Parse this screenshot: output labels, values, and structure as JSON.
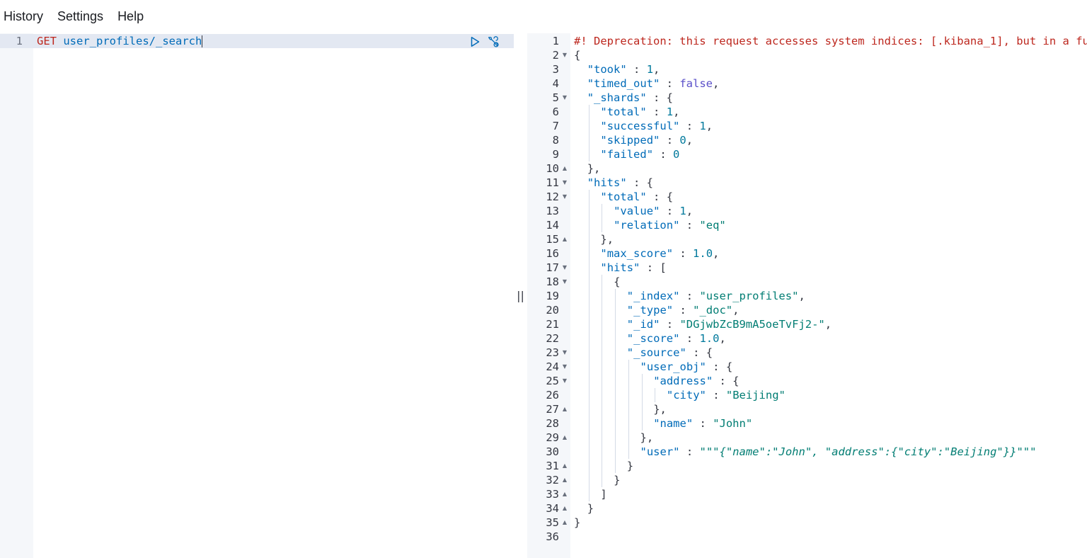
{
  "menubar": {
    "items": [
      "History",
      "Settings",
      "Help"
    ]
  },
  "request": {
    "line_number": "1",
    "method": "GET",
    "path": "user_profiles/_search"
  },
  "icons": {
    "run": "play-icon",
    "settings": "wrench-icon",
    "resizer": "drag-handle-icon"
  },
  "resizer_label": "||",
  "response": {
    "lines": [
      {
        "n": "1",
        "fold": "",
        "indent": 0,
        "tokens": [
          [
            "warn",
            "#! Deprecation: this request accesses system indices: [.kibana_1], but in a future major version, direct access"
          ]
        ]
      },
      {
        "n": "2",
        "fold": "down",
        "indent": 0,
        "tokens": [
          [
            "p",
            "{"
          ]
        ]
      },
      {
        "n": "3",
        "fold": "",
        "indent": 1,
        "tokens": [
          [
            "k",
            "\"took\""
          ],
          [
            "p",
            " : "
          ],
          [
            "n",
            "1"
          ],
          [
            "p",
            ","
          ]
        ]
      },
      {
        "n": "4",
        "fold": "",
        "indent": 1,
        "tokens": [
          [
            "k",
            "\"timed_out\""
          ],
          [
            "p",
            " : "
          ],
          [
            "b",
            "false"
          ],
          [
            "p",
            ","
          ]
        ]
      },
      {
        "n": "5",
        "fold": "down",
        "indent": 1,
        "tokens": [
          [
            "k",
            "\"_shards\""
          ],
          [
            "p",
            " : {"
          ]
        ]
      },
      {
        "n": "6",
        "fold": "",
        "indent": 2,
        "tokens": [
          [
            "k",
            "\"total\""
          ],
          [
            "p",
            " : "
          ],
          [
            "n",
            "1"
          ],
          [
            "p",
            ","
          ]
        ]
      },
      {
        "n": "7",
        "fold": "",
        "indent": 2,
        "tokens": [
          [
            "k",
            "\"successful\""
          ],
          [
            "p",
            " : "
          ],
          [
            "n",
            "1"
          ],
          [
            "p",
            ","
          ]
        ]
      },
      {
        "n": "8",
        "fold": "",
        "indent": 2,
        "tokens": [
          [
            "k",
            "\"skipped\""
          ],
          [
            "p",
            " : "
          ],
          [
            "n",
            "0"
          ],
          [
            "p",
            ","
          ]
        ]
      },
      {
        "n": "9",
        "fold": "",
        "indent": 2,
        "tokens": [
          [
            "k",
            "\"failed\""
          ],
          [
            "p",
            " : "
          ],
          [
            "n",
            "0"
          ]
        ]
      },
      {
        "n": "10",
        "fold": "up",
        "indent": 1,
        "tokens": [
          [
            "p",
            "},"
          ]
        ]
      },
      {
        "n": "11",
        "fold": "down",
        "indent": 1,
        "tokens": [
          [
            "k",
            "\"hits\""
          ],
          [
            "p",
            " : {"
          ]
        ]
      },
      {
        "n": "12",
        "fold": "down",
        "indent": 2,
        "tokens": [
          [
            "k",
            "\"total\""
          ],
          [
            "p",
            " : {"
          ]
        ]
      },
      {
        "n": "13",
        "fold": "",
        "indent": 3,
        "tokens": [
          [
            "k",
            "\"value\""
          ],
          [
            "p",
            " : "
          ],
          [
            "n",
            "1"
          ],
          [
            "p",
            ","
          ]
        ]
      },
      {
        "n": "14",
        "fold": "",
        "indent": 3,
        "tokens": [
          [
            "k",
            "\"relation\""
          ],
          [
            "p",
            " : "
          ],
          [
            "s",
            "\"eq\""
          ]
        ]
      },
      {
        "n": "15",
        "fold": "up",
        "indent": 2,
        "tokens": [
          [
            "p",
            "},"
          ]
        ]
      },
      {
        "n": "16",
        "fold": "",
        "indent": 2,
        "tokens": [
          [
            "k",
            "\"max_score\""
          ],
          [
            "p",
            " : "
          ],
          [
            "n",
            "1.0"
          ],
          [
            "p",
            ","
          ]
        ]
      },
      {
        "n": "17",
        "fold": "down",
        "indent": 2,
        "tokens": [
          [
            "k",
            "\"hits\""
          ],
          [
            "p",
            " : ["
          ]
        ]
      },
      {
        "n": "18",
        "fold": "down",
        "indent": 3,
        "tokens": [
          [
            "p",
            "{"
          ]
        ]
      },
      {
        "n": "19",
        "fold": "",
        "indent": 4,
        "tokens": [
          [
            "k",
            "\"_index\""
          ],
          [
            "p",
            " : "
          ],
          [
            "s",
            "\"user_profiles\""
          ],
          [
            "p",
            ","
          ]
        ]
      },
      {
        "n": "20",
        "fold": "",
        "indent": 4,
        "tokens": [
          [
            "k",
            "\"_type\""
          ],
          [
            "p",
            " : "
          ],
          [
            "s",
            "\"_doc\""
          ],
          [
            "p",
            ","
          ]
        ]
      },
      {
        "n": "21",
        "fold": "",
        "indent": 4,
        "tokens": [
          [
            "k",
            "\"_id\""
          ],
          [
            "p",
            " : "
          ],
          [
            "s",
            "\"DGjwbZcB9mA5oeTvFj2-\""
          ],
          [
            "p",
            ","
          ]
        ]
      },
      {
        "n": "22",
        "fold": "",
        "indent": 4,
        "tokens": [
          [
            "k",
            "\"_score\""
          ],
          [
            "p",
            " : "
          ],
          [
            "n",
            "1.0"
          ],
          [
            "p",
            ","
          ]
        ]
      },
      {
        "n": "23",
        "fold": "down",
        "indent": 4,
        "tokens": [
          [
            "k",
            "\"_source\""
          ],
          [
            "p",
            " : {"
          ]
        ]
      },
      {
        "n": "24",
        "fold": "down",
        "indent": 5,
        "tokens": [
          [
            "k",
            "\"user_obj\""
          ],
          [
            "p",
            " : {"
          ]
        ]
      },
      {
        "n": "25",
        "fold": "down",
        "indent": 6,
        "tokens": [
          [
            "k",
            "\"address\""
          ],
          [
            "p",
            " : {"
          ]
        ]
      },
      {
        "n": "26",
        "fold": "",
        "indent": 7,
        "tokens": [
          [
            "k",
            "\"city\""
          ],
          [
            "p",
            " : "
          ],
          [
            "s",
            "\"Beijing\""
          ]
        ]
      },
      {
        "n": "27",
        "fold": "up",
        "indent": 6,
        "tokens": [
          [
            "p",
            "},"
          ]
        ]
      },
      {
        "n": "28",
        "fold": "",
        "indent": 6,
        "tokens": [
          [
            "k",
            "\"name\""
          ],
          [
            "p",
            " : "
          ],
          [
            "s",
            "\"John\""
          ]
        ]
      },
      {
        "n": "29",
        "fold": "up",
        "indent": 5,
        "tokens": [
          [
            "p",
            "},"
          ]
        ]
      },
      {
        "n": "30",
        "fold": "",
        "indent": 5,
        "tokens": [
          [
            "k",
            "\"user\""
          ],
          [
            "p",
            " : "
          ],
          [
            "s",
            "\"\"\""
          ],
          [
            "tq",
            "{\"name\":\"John\", \"address\":{\"city\":\"Beijing\"}}"
          ],
          [
            "s",
            "\"\"\""
          ]
        ]
      },
      {
        "n": "31",
        "fold": "up",
        "indent": 4,
        "tokens": [
          [
            "p",
            "}"
          ]
        ]
      },
      {
        "n": "32",
        "fold": "up",
        "indent": 3,
        "tokens": [
          [
            "p",
            "}"
          ]
        ]
      },
      {
        "n": "33",
        "fold": "up",
        "indent": 2,
        "tokens": [
          [
            "p",
            "]"
          ]
        ]
      },
      {
        "n": "34",
        "fold": "up",
        "indent": 1,
        "tokens": [
          [
            "p",
            "}"
          ]
        ]
      },
      {
        "n": "35",
        "fold": "up",
        "indent": 0,
        "tokens": [
          [
            "p",
            "}"
          ]
        ]
      },
      {
        "n": "36",
        "fold": "",
        "indent": 0,
        "tokens": []
      }
    ]
  },
  "colors": {
    "method": "#bd271e",
    "url": "#006bb8",
    "key": "#006bb8",
    "number": "#00799c",
    "boolean": "#5a4fc9",
    "string": "#017d73",
    "warning": "#bd271e",
    "gutter": "#f5f7fa",
    "active_line": "#e3e8f2"
  }
}
